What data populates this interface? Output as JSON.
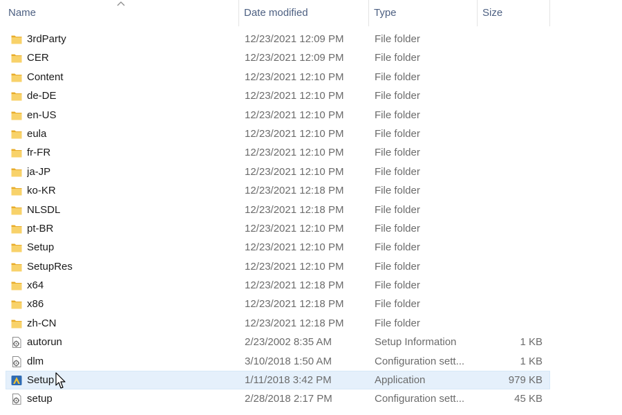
{
  "columns": {
    "name": "Name",
    "date_modified": "Date modified",
    "type": "Type",
    "size": "Size"
  },
  "colors": {
    "header_text": "#4d6082",
    "folder": "#f6c75a",
    "selection": "#e5f0fb"
  },
  "rows": [
    {
      "name": "3rdParty",
      "date": "12/23/2021 12:09 PM",
      "type": "File folder",
      "size": "",
      "icon": "folder-icon"
    },
    {
      "name": "CER",
      "date": "12/23/2021 12:09 PM",
      "type": "File folder",
      "size": "",
      "icon": "folder-icon"
    },
    {
      "name": "Content",
      "date": "12/23/2021 12:10 PM",
      "type": "File folder",
      "size": "",
      "icon": "folder-icon"
    },
    {
      "name": "de-DE",
      "date": "12/23/2021 12:10 PM",
      "type": "File folder",
      "size": "",
      "icon": "folder-icon"
    },
    {
      "name": "en-US",
      "date": "12/23/2021 12:10 PM",
      "type": "File folder",
      "size": "",
      "icon": "folder-icon"
    },
    {
      "name": "eula",
      "date": "12/23/2021 12:10 PM",
      "type": "File folder",
      "size": "",
      "icon": "folder-icon"
    },
    {
      "name": "fr-FR",
      "date": "12/23/2021 12:10 PM",
      "type": "File folder",
      "size": "",
      "icon": "folder-icon"
    },
    {
      "name": "ja-JP",
      "date": "12/23/2021 12:10 PM",
      "type": "File folder",
      "size": "",
      "icon": "folder-icon"
    },
    {
      "name": "ko-KR",
      "date": "12/23/2021 12:18 PM",
      "type": "File folder",
      "size": "",
      "icon": "folder-icon"
    },
    {
      "name": "NLSDL",
      "date": "12/23/2021 12:18 PM",
      "type": "File folder",
      "size": "",
      "icon": "folder-icon"
    },
    {
      "name": "pt-BR",
      "date": "12/23/2021 12:10 PM",
      "type": "File folder",
      "size": "",
      "icon": "folder-icon"
    },
    {
      "name": "Setup",
      "date": "12/23/2021 12:10 PM",
      "type": "File folder",
      "size": "",
      "icon": "folder-icon"
    },
    {
      "name": "SetupRes",
      "date": "12/23/2021 12:10 PM",
      "type": "File folder",
      "size": "",
      "icon": "folder-icon"
    },
    {
      "name": "x64",
      "date": "12/23/2021 12:18 PM",
      "type": "File folder",
      "size": "",
      "icon": "folder-icon"
    },
    {
      "name": "x86",
      "date": "12/23/2021 12:18 PM",
      "type": "File folder",
      "size": "",
      "icon": "folder-icon"
    },
    {
      "name": "zh-CN",
      "date": "12/23/2021 12:18 PM",
      "type": "File folder",
      "size": "",
      "icon": "folder-icon"
    },
    {
      "name": "autorun",
      "date": "2/23/2002 8:35 AM",
      "type": "Setup Information",
      "size": "1 KB",
      "icon": "settings-file-icon"
    },
    {
      "name": "dlm",
      "date": "3/10/2018 1:50 AM",
      "type": "Configuration sett...",
      "size": "1 KB",
      "icon": "settings-file-icon"
    },
    {
      "name": "Setup",
      "date": "1/11/2018 3:42 PM",
      "type": "Application",
      "size": "979 KB",
      "icon": "application-icon",
      "selected": true
    },
    {
      "name": "setup",
      "date": "2/28/2018 2:17 PM",
      "type": "Configuration sett...",
      "size": "45 KB",
      "icon": "settings-file-icon"
    }
  ]
}
